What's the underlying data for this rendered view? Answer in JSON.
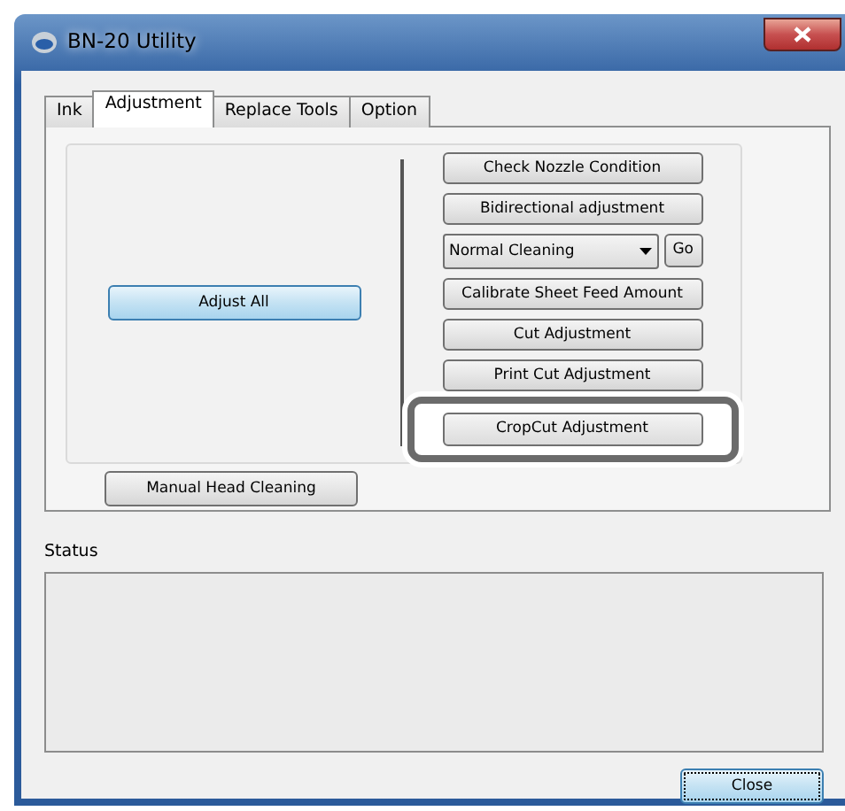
{
  "window": {
    "title": "BN-20 Utility"
  },
  "tabs": [
    {
      "label": "Ink",
      "selected": false
    },
    {
      "label": "Adjustment",
      "selected": true
    },
    {
      "label": "Replace Tools",
      "selected": false
    },
    {
      "label": "Option",
      "selected": false
    }
  ],
  "left_buttons": [
    {
      "label": "Adjust All",
      "focused": true
    }
  ],
  "right_controls": [
    {
      "kind": "button",
      "label": "Check Nozzle Condition",
      "highlighted": false
    },
    {
      "kind": "button",
      "label": "Bidirectional adjustment",
      "highlighted": false
    },
    {
      "kind": "dropdown",
      "value": "Normal Cleaning",
      "button": "Go"
    },
    {
      "kind": "button",
      "label": "Calibrate Sheet Feed Amount",
      "highlighted": false
    },
    {
      "kind": "button",
      "label": "Cut Adjustment",
      "highlighted": false
    },
    {
      "kind": "button",
      "label": "Print  Cut Adjustment",
      "highlighted": false
    },
    {
      "kind": "button",
      "label": "CropCut Adjustment",
      "highlighted": true
    }
  ],
  "bottom_button": {
    "label": "Manual Head Cleaning",
    "focused": false
  },
  "status": {
    "label": "Status"
  },
  "close_button": {
    "label": "Close",
    "focused": true
  }
}
